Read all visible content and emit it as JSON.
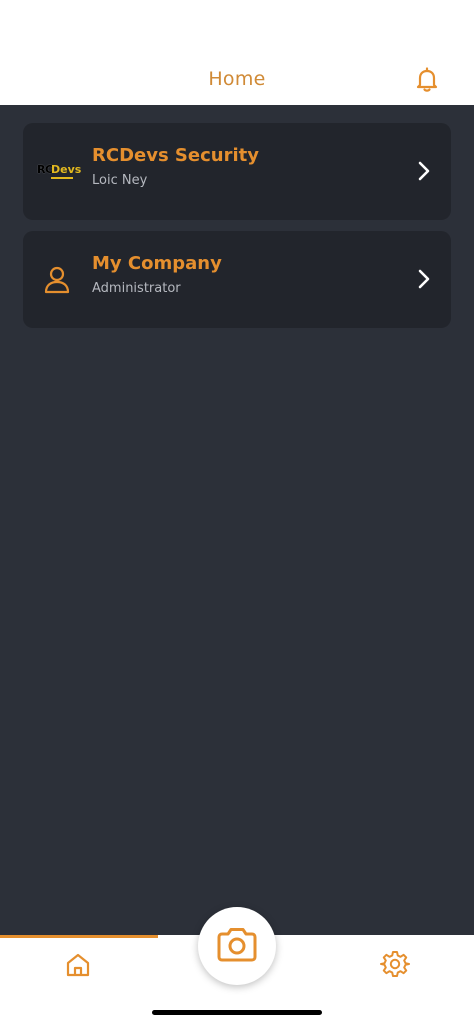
{
  "header": {
    "title": "Home",
    "notification_icon": "bell-icon"
  },
  "accounts": [
    {
      "name": "RCDevs Security",
      "subtitle": "Loic Ney",
      "icon": "rcdevs-logo",
      "logo_text_rc": "RC",
      "logo_text_devs": "Devs"
    },
    {
      "name": "My Company",
      "subtitle": "Administrator",
      "icon": "person-icon"
    }
  ],
  "bottom_nav": {
    "items": [
      {
        "icon": "home-icon",
        "active": true
      },
      {
        "icon": "camera-icon"
      },
      {
        "icon": "gear-icon"
      }
    ]
  },
  "colors": {
    "accent": "#e58f2e",
    "background": "#2c3039",
    "card": "#22252c"
  }
}
